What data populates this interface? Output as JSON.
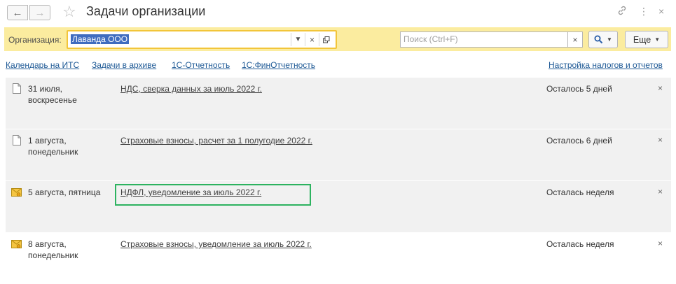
{
  "window": {
    "title": "Задачи организации"
  },
  "filter": {
    "org_label": "Организация:",
    "org_value": "Лаванда ООО",
    "search_placeholder": "Поиск (Ctrl+F)",
    "more_label": "Еще"
  },
  "links": {
    "calendar": "Календарь на ИТС",
    "archive": "Задачи в архиве",
    "reporting": "1С-Отчетность",
    "fin_reporting": "1С:ФинОтчетность",
    "tax_settings": "Настройка налогов и отчетов"
  },
  "tasks": [
    {
      "date_line1": "31 июля,",
      "date_line2": "воскресенье",
      "title": "НДС, сверка данных за июль 2022 г.",
      "remaining": "Осталось 5 дней",
      "icon": "document-icon"
    },
    {
      "date_line1": "1 августа,",
      "date_line2": "понедельник",
      "title": "Страховые взносы, расчет за 1 полугодие 2022 г.",
      "remaining": "Осталось 6 дней",
      "icon": "document-icon"
    },
    {
      "date_line1": "5 августа, пятница",
      "date_line2": "",
      "title": "НДФЛ, уведомление за июль 2022 г.",
      "remaining": "Осталась неделя",
      "icon": "envelope-icon"
    },
    {
      "date_line1": "8 августа,",
      "date_line2": "понедельник",
      "title": "Страховые взносы, уведомление за июль 2022 г.",
      "remaining": "Осталась неделя",
      "icon": "envelope-icon"
    }
  ],
  "colors": {
    "filter_bar_bg": "#fbec9f",
    "input_focus_border": "#f2c53a",
    "link": "#1f5a96",
    "highlight_frame": "#2db360",
    "row_bg": "#f1f1f1"
  }
}
